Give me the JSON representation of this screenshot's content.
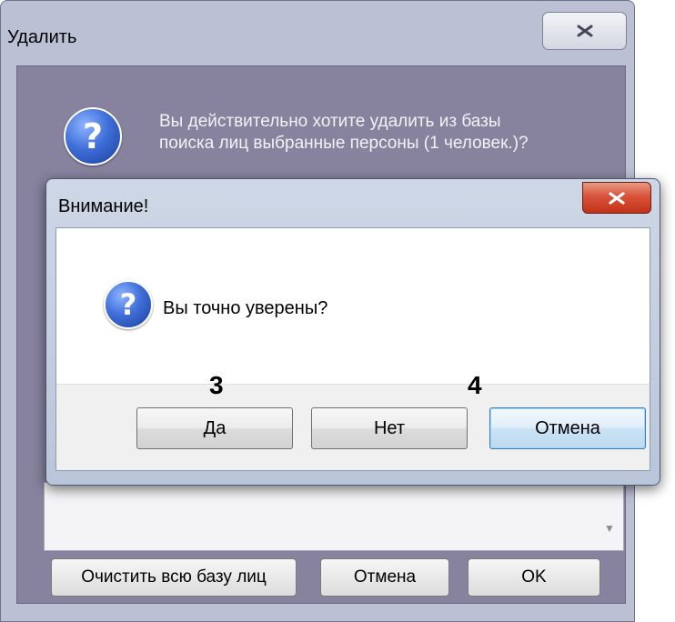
{
  "back_dialog": {
    "title": "Удалить",
    "message_line1": "Вы действительно хотите удалить из базы",
    "message_line2": "поиска лиц выбранные персоны (1 человек.)?",
    "buttons": {
      "clear_all": "Очистить всю базу лиц",
      "cancel": "Отмена",
      "ok": "OK"
    },
    "icon": "question-icon"
  },
  "front_dialog": {
    "title": "Внимание!",
    "message": "Вы точно уверены?",
    "buttons": {
      "yes": "Да",
      "no": "Нет",
      "cancel": "Отмена"
    },
    "focused_button": "cancel",
    "icon": "question-icon",
    "close_button_color": "#c8381f"
  },
  "callouts": {
    "callout_3": "3",
    "callout_4": "4"
  },
  "colors": {
    "back_client_bg": "#87839f",
    "back_frame_bg": "#bcc0d4",
    "front_frame_bg": "#c4cedf"
  }
}
